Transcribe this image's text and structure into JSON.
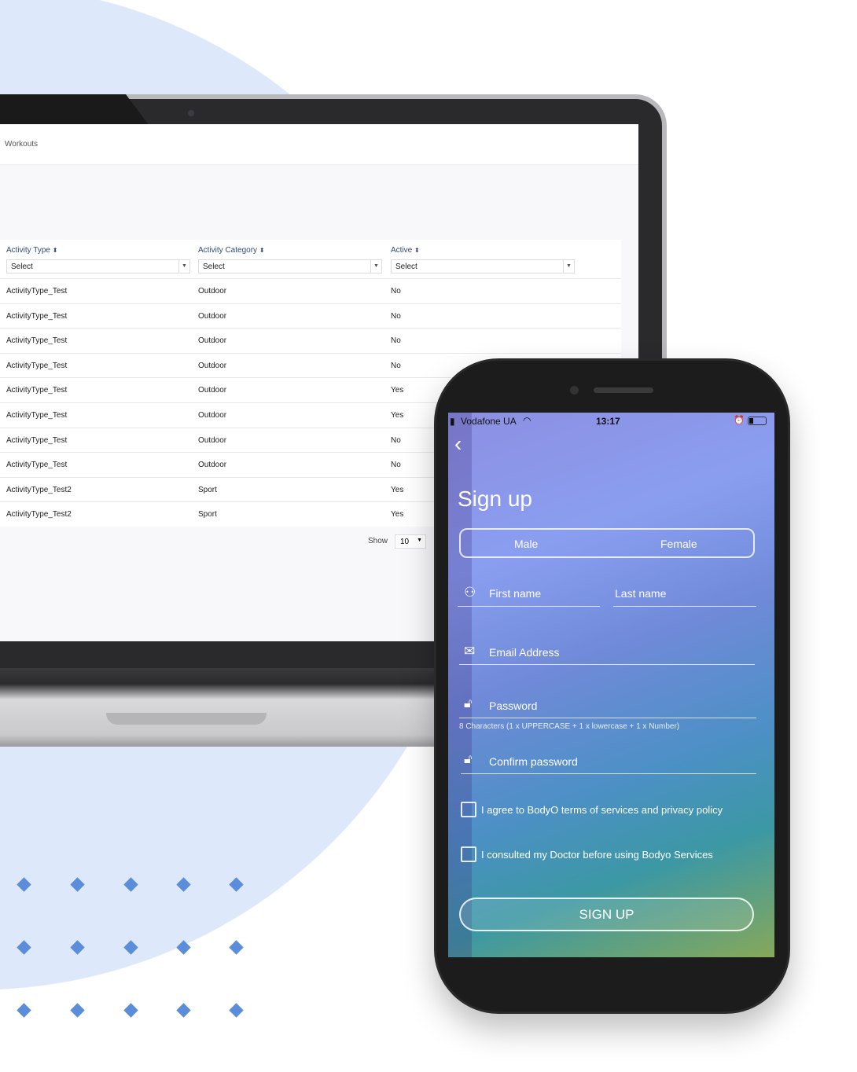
{
  "laptop": {
    "breadcrumb": "Workouts",
    "columns": [
      {
        "label": "Activity Type",
        "filter": "Select"
      },
      {
        "label": "Activity Category",
        "filter": "Select"
      },
      {
        "label": "Active",
        "filter": "Select"
      }
    ],
    "sort_icon": "sort-icon",
    "rows": [
      [
        "ActivityType_Test",
        "Outdoor",
        "No"
      ],
      [
        "ActivityType_Test",
        "Outdoor",
        "No"
      ],
      [
        "ActivityType_Test",
        "Outdoor",
        "No"
      ],
      [
        "ActivityType_Test",
        "Outdoor",
        "No"
      ],
      [
        "ActivityType_Test",
        "Outdoor",
        "Yes"
      ],
      [
        "ActivityType_Test",
        "Outdoor",
        "Yes"
      ],
      [
        "ActivityType_Test",
        "Outdoor",
        "No"
      ],
      [
        "ActivityType_Test",
        "Outdoor",
        "No"
      ],
      [
        "ActivityType_Test2",
        "Sport",
        "Yes"
      ],
      [
        "ActivityType_Test2",
        "Sport",
        "Yes"
      ]
    ],
    "show_label": "Show",
    "show_value": "10"
  },
  "phone": {
    "carrier": "Vodafone UA",
    "time": "13:17",
    "title": "Sign up",
    "gender": [
      "Male",
      "Female"
    ],
    "first_name": "First name",
    "last_name": "Last name",
    "email": "Email Address",
    "password": "Password",
    "password_hint": "8 Characters (1 x UPPERCASE + 1 x lowercase + 1 x Number)",
    "confirm_password": "Confirm password",
    "agree_terms": "I agree to BodyO terms of services and privacy policy",
    "consulted_doctor": "I consulted my Doctor before using Bodyo Services",
    "signup_button": "SIGN UP"
  },
  "colors": {
    "circle": "#dde8fa",
    "diamond": "#5b8ddb",
    "table_header": "#2f4a78"
  }
}
